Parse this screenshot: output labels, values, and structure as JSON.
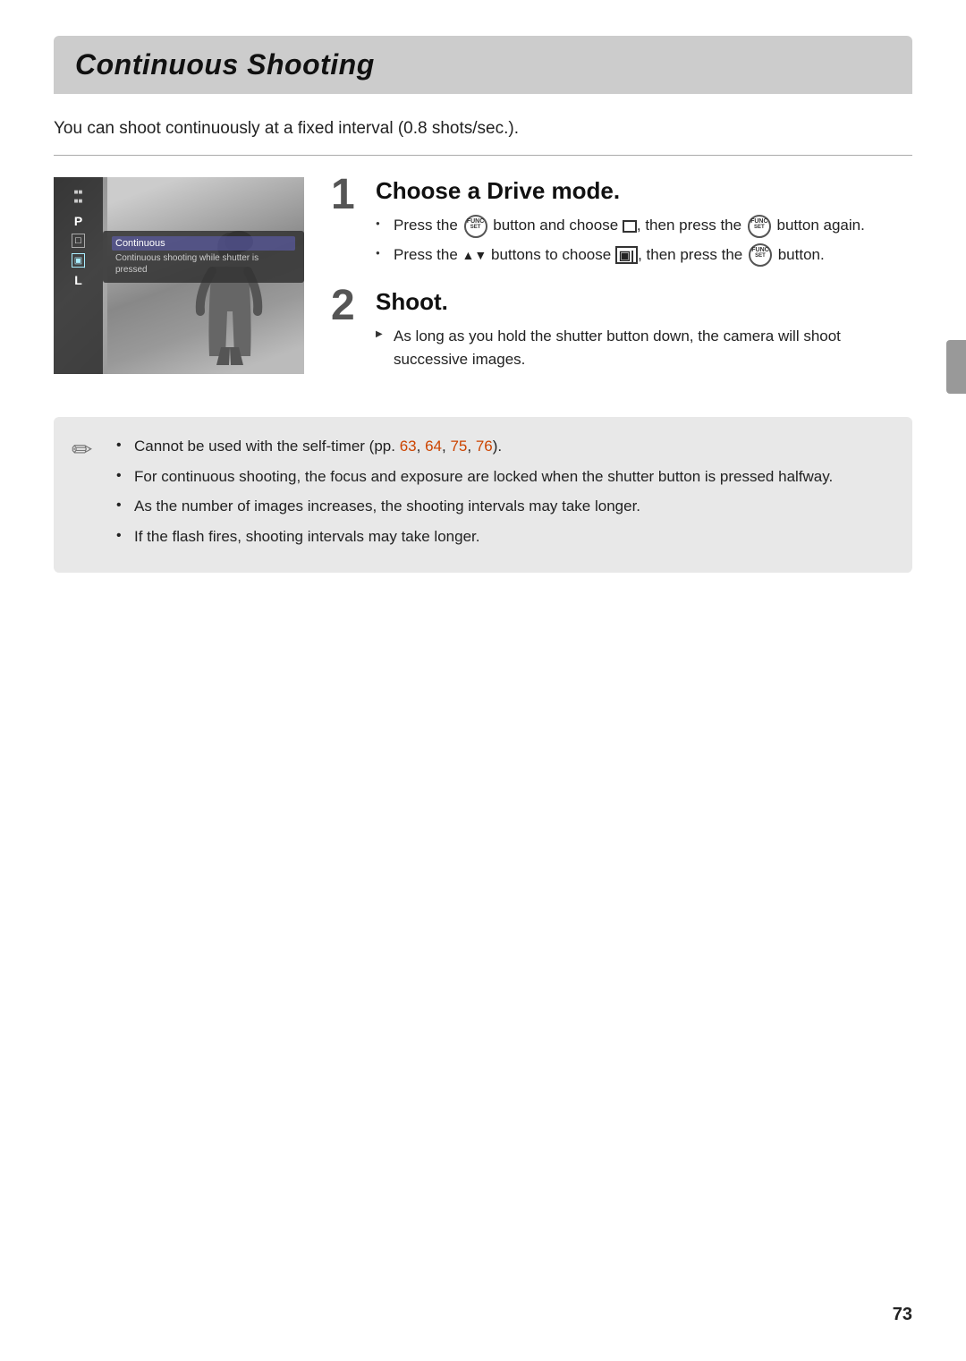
{
  "page": {
    "title": "Continuous Shooting",
    "subtitle": "You can shoot continuously at a fixed interval (0.8 shots/sec.).",
    "page_number": "73"
  },
  "step1": {
    "number": "1",
    "title": "Choose a Drive mode.",
    "bullets": [
      {
        "text_before": "Press the",
        "button_label": "FUNC/SET",
        "text_after": "button and choose",
        "symbol": "□",
        "text_end": ", then press the",
        "button2": "FUNC/SET",
        "text_final": "button again."
      },
      {
        "text_before": "Press the ▲▼ buttons to choose",
        "symbol": "▣",
        "text_end": ", then press the",
        "button": "FUNC/SET",
        "text_final": "button."
      }
    ]
  },
  "step2": {
    "number": "2",
    "title": "Shoot.",
    "bullets": [
      "As long as you hold the shutter button down, the camera will shoot successive images."
    ]
  },
  "notes": [
    {
      "text": "Cannot be used with the self-timer (pp. 63, 64, 75, 76).",
      "has_links": true,
      "links": [
        "63",
        "64",
        "75",
        "76"
      ]
    },
    {
      "text": "For continuous shooting, the focus and exposure are locked when the shutter button is pressed halfway.",
      "has_links": false
    },
    {
      "text": "As the number of images increases, the shooting intervals may take longer.",
      "has_links": false
    },
    {
      "text": "If the flash fires, shooting intervals may take longer.",
      "has_links": false
    }
  ],
  "camera_menu": {
    "label": "Continuous",
    "sublabel": "Continuous shooting while shutter is pressed"
  },
  "icons": {
    "func_set": "FUNC/SET",
    "pencil_note": "✏"
  }
}
